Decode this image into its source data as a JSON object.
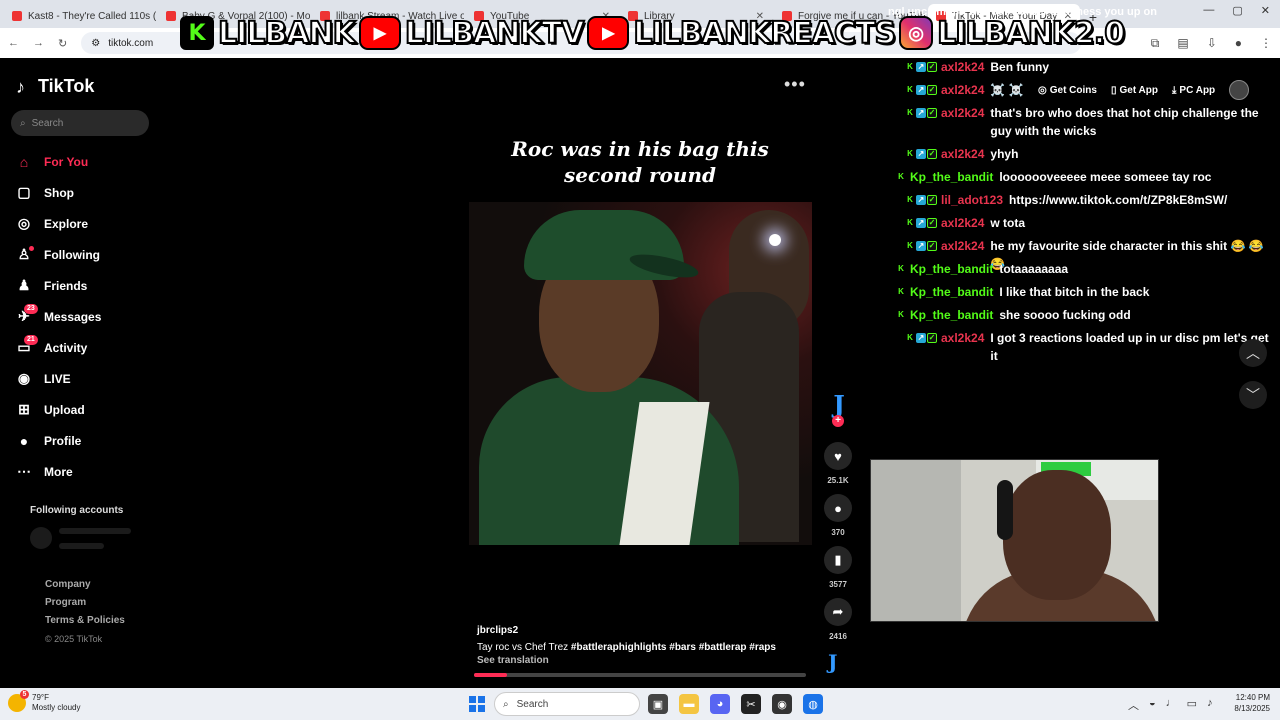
{
  "browser": {
    "tabs": [
      {
        "title": "Kast8 - They're Called 110s (M"
      },
      {
        "title": "Baby G & Vorpal 2(100) - Move"
      },
      {
        "title": "lilbank Stream - Watch Live on"
      },
      {
        "title": "YouTube"
      },
      {
        "title": "Library"
      },
      {
        "title": "Forgive me if u can - YouTube"
      },
      {
        "title": "TikTok - Make Your Day",
        "active": true
      }
    ],
    "url": "tiktok.com"
  },
  "banner": {
    "k_glyph": "K",
    "play_glyph": "▶",
    "ig_glyph": "◎",
    "items": [
      "LILBANK",
      "LILBANKTV",
      "LILBANKREACTS",
      "LILBANK2.0"
    ]
  },
  "sidebar": {
    "logo": "TikTok",
    "search_placeholder": "Search",
    "items": [
      {
        "label": "For You",
        "icon": "home-icon",
        "glyph": "⌂"
      },
      {
        "label": "Shop",
        "icon": "shopping-bag-icon",
        "glyph": "▢"
      },
      {
        "label": "Explore",
        "icon": "compass-icon",
        "glyph": "◎"
      },
      {
        "label": "Following",
        "icon": "following-icon",
        "glyph": "♙"
      },
      {
        "label": "Friends",
        "icon": "friends-icon",
        "glyph": "♟"
      },
      {
        "label": "Messages",
        "icon": "messages-icon",
        "glyph": "✈",
        "badge": "23"
      },
      {
        "label": "Activity",
        "icon": "activity-icon",
        "glyph": "▭",
        "badge": "21"
      },
      {
        "label": "LIVE",
        "icon": "live-icon",
        "glyph": "◉"
      },
      {
        "label": "Upload",
        "icon": "upload-icon",
        "glyph": "⊞"
      },
      {
        "label": "Profile",
        "icon": "profile-icon",
        "glyph": "●"
      },
      {
        "label": "More",
        "icon": "more-icon",
        "glyph": "⋯"
      }
    ],
    "following_accounts_label": "Following accounts",
    "footer": [
      "Company",
      "Program",
      "Terms & Policies"
    ],
    "copyright": "© 2025 TikTok"
  },
  "video": {
    "caption_line1": "Roc was in his bag this",
    "caption_line2": "second round",
    "author": "jbrclips2",
    "description": "Tay roc vs Chef Trez",
    "hashtags": "#battleraphighlights  #bars  #battlerap  #raps",
    "see_translation": "See translation",
    "progress": 0.1,
    "likes": "25.1K",
    "comments": "370",
    "saves": "3577",
    "shares": "2416"
  },
  "top_buttons": {
    "get_coins": "Get Coins",
    "get_app": "Get App",
    "pc_app": "PC App"
  },
  "chat": {
    "top_partial": "ngl unc I might be your Barber and mess you up on",
    "messages": [
      {
        "user": "axl2k24",
        "color": "#e8344e",
        "badges": [
          "k",
          "s",
          "g"
        ],
        "text": "Ben funny"
      },
      {
        "user": "axl2k24",
        "color": "#e8344e",
        "badges": [
          "k",
          "s",
          "g"
        ],
        "text": "☠️ ☠️"
      },
      {
        "user": "axl2k24",
        "color": "#e8344e",
        "badges": [
          "k",
          "s",
          "g"
        ],
        "text": "that's bro who does that hot chip challenge the guy with the wicks"
      },
      {
        "user": "axl2k24",
        "color": "#e8344e",
        "badges": [
          "k",
          "s",
          "g"
        ],
        "text": "yhyh"
      },
      {
        "user": "Kp_the_bandit",
        "color": "#53fc18",
        "badges": [
          "k"
        ],
        "text": "looooooveeeee meee someee tay roc"
      },
      {
        "user": "lil_adot123",
        "color": "#e8344e",
        "badges": [
          "k",
          "s",
          "g"
        ],
        "text": "https://www.tiktok.com/t/ZP8kE8mSW/"
      },
      {
        "user": "axl2k24",
        "color": "#e8344e",
        "badges": [
          "k",
          "s",
          "g"
        ],
        "text": "w tota"
      },
      {
        "user": "axl2k24",
        "color": "#e8344e",
        "badges": [
          "k",
          "s",
          "g"
        ],
        "text": "he my favourite side character in this shit 😂 😂 😂"
      },
      {
        "user": "Kp_the_bandit",
        "color": "#53fc18",
        "badges": [
          "k"
        ],
        "text": "totaaaaaaaa"
      },
      {
        "user": "Kp_the_bandit",
        "color": "#53fc18",
        "badges": [
          "k"
        ],
        "text": "I like that bitch in the back"
      },
      {
        "user": "Kp_the_bandit",
        "color": "#53fc18",
        "badges": [
          "k"
        ],
        "text": "she soooo fucking odd"
      },
      {
        "user": "axl2k24",
        "color": "#e8344e",
        "badges": [
          "k",
          "s",
          "g"
        ],
        "text": "I got 3 reactions loaded up in ur disc pm let's get it"
      }
    ]
  },
  "taskbar": {
    "weather_temp": "79°F",
    "weather_desc": "Mostly cloudy",
    "weather_badge": "5",
    "search": "Search",
    "time": "12:40 PM",
    "date": "8/13/2025"
  },
  "colors": {
    "accent": "#fe2c55",
    "kick_green": "#53fc18",
    "chat_red": "#e8344e"
  }
}
